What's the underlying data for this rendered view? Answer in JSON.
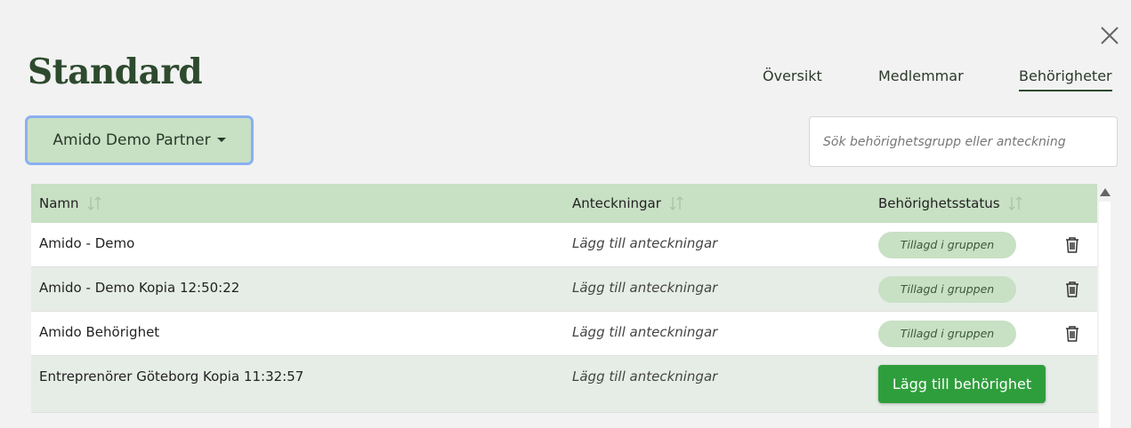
{
  "header": {
    "title": "Standard",
    "close_icon": "close-icon"
  },
  "tabs": [
    {
      "label": "Översikt",
      "active": false
    },
    {
      "label": "Medlemmar",
      "active": false
    },
    {
      "label": "Behörigheter",
      "active": true
    }
  ],
  "partner_dropdown": {
    "selected": "Amido Demo Partner",
    "accent": "#c8e0c4",
    "focus_ring": "#8ab0f0"
  },
  "search": {
    "placeholder": "Sök behörighetsgrupp eller anteckning",
    "value": ""
  },
  "table": {
    "columns": [
      {
        "label": "Namn",
        "sortable": true
      },
      {
        "label": "Anteckningar",
        "sortable": true
      },
      {
        "label": "Behörighetsstatus",
        "sortable": true
      }
    ],
    "rows": [
      {
        "name": "Amido - Demo",
        "note": "Lägg till anteckningar",
        "status": "Tillagd i gruppen",
        "has_delete": true
      },
      {
        "name": "Amido - Demo Kopia 12:50:22",
        "note": "Lägg till anteckningar",
        "status": "Tillagd i gruppen",
        "has_delete": true
      },
      {
        "name": "Amido Behörighet",
        "note": "Lägg till anteckningar",
        "status": "Tillagd i gruppen",
        "has_delete": true
      },
      {
        "name": "Entreprenörer Göteborg Kopia 11:32:57",
        "note": "Lägg till anteckningar",
        "action": "Lägg till behörighet",
        "has_delete": false
      }
    ]
  },
  "colors": {
    "header_bg": "#c8e0c4",
    "row_tint": "#e6ede7",
    "primary_button": "#2e9e3c",
    "title_color": "#2e4a2e"
  }
}
